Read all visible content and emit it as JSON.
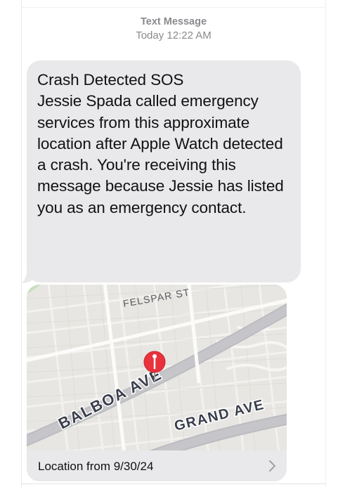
{
  "header": {
    "service": "Text Message",
    "timestamp": "Today 12:22 AM"
  },
  "message": {
    "text": "Crash Detected SOS\nJessie Spada called emergency services from this approximate location after Apple Watch detected a crash. You're receiving this message because Jessie has listed you as an emergency contact."
  },
  "map": {
    "street_labels": {
      "felspar": "FELSPAR ST",
      "balboa": "BALBOA AVE",
      "grand": "GRAND AVE"
    },
    "pin_color": "#e8323c",
    "footer_label": "Location from 9/30/24",
    "chevron_icon": "chevron-right-icon"
  },
  "colors": {
    "bubble": "#e9e9eb",
    "meta_text": "#8a8a8e",
    "map_background": "#e7e6e2",
    "major_road": "#bcbcc0"
  }
}
